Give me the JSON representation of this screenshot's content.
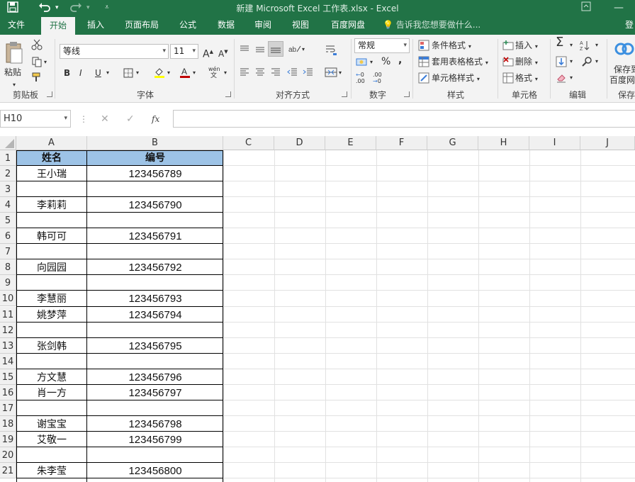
{
  "window": {
    "title": "新建 Microsoft Excel 工作表.xlsx - Excel"
  },
  "quick_access": {
    "save_icon": "save-icon",
    "undo_icon": "undo-icon",
    "redo_icon": "redo-icon",
    "customize_icon": "customize-icon"
  },
  "menu": {
    "items": [
      "文件",
      "开始",
      "插入",
      "页面布局",
      "公式",
      "数据",
      "审阅",
      "视图",
      "百度网盘"
    ],
    "active": "开始",
    "tellme": "告诉我您想要做什么...",
    "login": "登"
  },
  "ribbon": {
    "clipboard": {
      "paste_label": "粘贴",
      "group": "剪贴板"
    },
    "font": {
      "name": "等线",
      "size": "11",
      "bold": "B",
      "italic": "I",
      "underline": "U",
      "group": "字体",
      "phonetic": "wén"
    },
    "alignment": {
      "group": "对齐方式"
    },
    "number": {
      "format": "常规",
      "percent": "%",
      "comma": ",",
      "inc_dec": ".00",
      "dec_dec": ".00",
      "group": "数字"
    },
    "styles": {
      "conditional": "条件格式",
      "table": "套用表格格式",
      "cell": "单元格样式",
      "group": "样式"
    },
    "cells": {
      "insert": "插入",
      "delete": "删除",
      "format": "格式",
      "group": "单元格"
    },
    "editing": {
      "group": "编辑"
    },
    "save": {
      "label1": "保存到",
      "label2": "百度网",
      "group": "保存"
    }
  },
  "formula_bar": {
    "name_box": "H10",
    "fx": "fx",
    "value": ""
  },
  "columns": [
    "A",
    "B",
    "C",
    "D",
    "E",
    "F",
    "G",
    "H",
    "I",
    "J"
  ],
  "rows": [
    "1",
    "2",
    "3",
    "4",
    "5",
    "6",
    "7",
    "8",
    "9",
    "10",
    "11",
    "12",
    "13",
    "14",
    "15",
    "16",
    "17",
    "18",
    "19",
    "20",
    "21"
  ],
  "header": {
    "a1": "姓名",
    "b1": "编号"
  },
  "header_fill": "#9dc3e6",
  "data": [
    {
      "row": "2",
      "name": "王小瑞",
      "id": "123456789"
    },
    {
      "row": "3",
      "name": "",
      "id": ""
    },
    {
      "row": "4",
      "name": "李莉莉",
      "id": "123456790"
    },
    {
      "row": "5",
      "name": "",
      "id": ""
    },
    {
      "row": "6",
      "name": "韩可可",
      "id": "123456791"
    },
    {
      "row": "7",
      "name": "",
      "id": ""
    },
    {
      "row": "8",
      "name": "向园园",
      "id": "123456792"
    },
    {
      "row": "9",
      "name": "",
      "id": ""
    },
    {
      "row": "10",
      "name": "李慧丽",
      "id": "123456793"
    },
    {
      "row": "11",
      "name": "姚梦萍",
      "id": "123456794"
    },
    {
      "row": "12",
      "name": "",
      "id": ""
    },
    {
      "row": "13",
      "name": "张剑韩",
      "id": "123456795"
    },
    {
      "row": "14",
      "name": "",
      "id": ""
    },
    {
      "row": "15",
      "name": "方文慧",
      "id": "123456796"
    },
    {
      "row": "16",
      "name": "肖一方",
      "id": "123456797"
    },
    {
      "row": "17",
      "name": "",
      "id": ""
    },
    {
      "row": "18",
      "name": "谢宝宝",
      "id": "123456798"
    },
    {
      "row": "19",
      "name": "艾敬一",
      "id": "123456799"
    },
    {
      "row": "20",
      "name": "",
      "id": ""
    },
    {
      "row": "21",
      "name": "朱李莹",
      "id": "123456800"
    }
  ],
  "colors": {
    "excel_green": "#217346",
    "ribbon_bg": "#f3f3f3"
  }
}
